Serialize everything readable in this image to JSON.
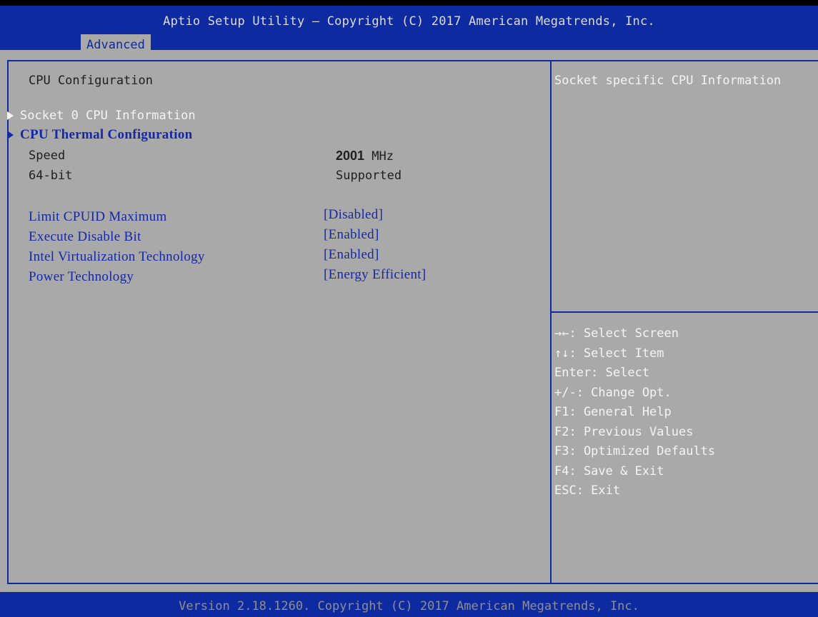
{
  "header": {
    "title": "Aptio Setup Utility – Copyright (C) 2017 American Megatrends, Inc.",
    "active_tab": "Advanced"
  },
  "main": {
    "section_title": "CPU Configuration",
    "submenus": [
      {
        "label": "Socket 0 CPU Information",
        "selected": true
      },
      {
        "label": "CPU Thermal Configuration",
        "selected": false
      }
    ],
    "info": [
      {
        "label": "Speed",
        "value_number": "2001",
        "value_unit": "MHz"
      },
      {
        "label": "64-bit",
        "value": "Supported"
      }
    ],
    "options": [
      {
        "label": "Limit CPUID Maximum",
        "value": "[Disabled]"
      },
      {
        "label": "Execute Disable Bit",
        "value": "[Enabled]"
      },
      {
        "label": "Intel Virtualization Technology",
        "value": "[Enabled]"
      },
      {
        "label": "Power Technology",
        "value": "[Energy Efficient]"
      }
    ]
  },
  "help_panel": {
    "description": "Socket specific CPU Information",
    "keys": [
      "→←: Select Screen",
      "↑↓: Select Item",
      "Enter: Select",
      "+/-: Change Opt.",
      "F1: General Help",
      "F2: Previous Values",
      "F3: Optimized Defaults",
      "F4: Save & Exit",
      "ESC: Exit"
    ]
  },
  "footer": {
    "version": "Version 2.18.1260. Copyright (C) 2017 American Megatrends, Inc."
  },
  "colors": {
    "bios_blue": "#0d2aa0",
    "panel_gray": "#a9a9a9",
    "highlight_white": "#f4f4f4",
    "option_blue": "#1428a8"
  }
}
